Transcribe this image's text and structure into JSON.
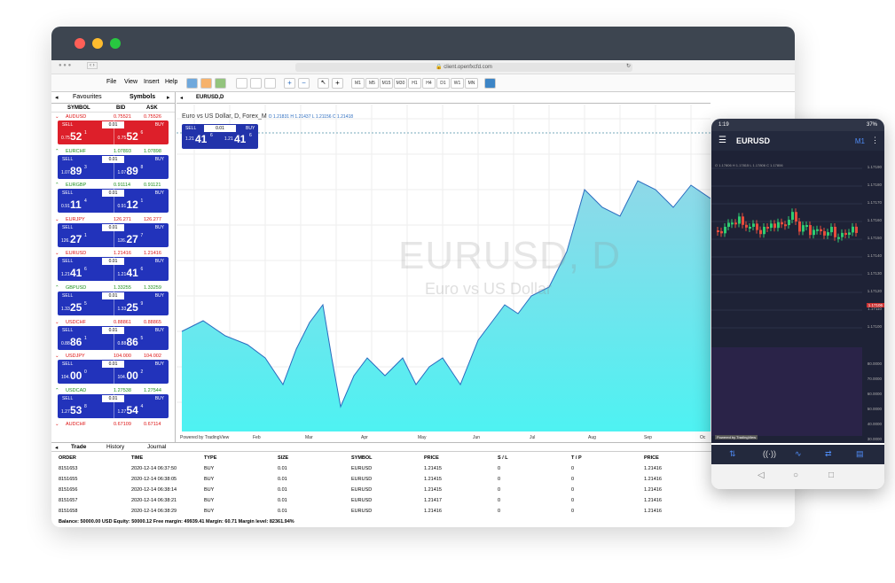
{
  "window": {
    "url": "client.openfxcfd.com"
  },
  "menu": {
    "file": "File",
    "view": "View",
    "insert": "Insert",
    "help": "Help",
    "timeframes": [
      "M1",
      "M5",
      "M15",
      "M30",
      "H1",
      "H4",
      "D1",
      "W1",
      "MN"
    ]
  },
  "sidebar": {
    "tabs": [
      "Favourites",
      "Symbols"
    ],
    "columns": [
      "SYMBOL",
      "BID",
      "ASK"
    ],
    "items": [
      {
        "symbol": "AUDUSD",
        "bid": "0.75521",
        "ask": "0.75526",
        "dir": "down",
        "sell_small": "0.75",
        "sell_big": "52",
        "sell_sup": "1",
        "buy_small": "0.75",
        "buy_big": "52",
        "buy_sup": "6",
        "lot": "0.01",
        "color": "red"
      },
      {
        "symbol": "EURCHF",
        "bid": "1.07893",
        "ask": "1.07898",
        "dir": "up",
        "sell_small": "1.07",
        "sell_big": "89",
        "sell_sup": "3",
        "buy_small": "1.07",
        "buy_big": "89",
        "buy_sup": "8",
        "lot": "0.01",
        "color": "blue"
      },
      {
        "symbol": "EURGBP",
        "bid": "0.91114",
        "ask": "0.91121",
        "dir": "up",
        "sell_small": "0.91",
        "sell_big": "11",
        "sell_sup": "4",
        "buy_small": "0.91",
        "buy_big": "12",
        "buy_sup": "1",
        "lot": "0.01",
        "color": "blue"
      },
      {
        "symbol": "EURJPY",
        "bid": "126.271",
        "ask": "126.277",
        "dir": "down",
        "sell_small": "126.",
        "sell_big": "27",
        "sell_sup": "1",
        "buy_small": "126.",
        "buy_big": "27",
        "buy_sup": "7",
        "lot": "0.01",
        "color": "blue"
      },
      {
        "symbol": "EURUSD",
        "bid": "1.21416",
        "ask": "1.21416",
        "dir": "down",
        "sell_small": "1.21",
        "sell_big": "41",
        "sell_sup": "6",
        "buy_small": "1.21",
        "buy_big": "41",
        "buy_sup": "6",
        "lot": "0.01",
        "color": "blue"
      },
      {
        "symbol": "GBPUSD",
        "bid": "1.33255",
        "ask": "1.33259",
        "dir": "up",
        "sell_small": "1.33",
        "sell_big": "25",
        "sell_sup": "5",
        "buy_small": "1.33",
        "buy_big": "25",
        "buy_sup": "9",
        "lot": "0.01",
        "color": "blue"
      },
      {
        "symbol": "USDCHF",
        "bid": "0.88861",
        "ask": "0.88865",
        "dir": "down",
        "sell_small": "0.88",
        "sell_big": "86",
        "sell_sup": "1",
        "buy_small": "0.88",
        "buy_big": "86",
        "buy_sup": "5",
        "lot": "0.01",
        "color": "blue"
      },
      {
        "symbol": "USDJPY",
        "bid": "104.000",
        "ask": "104.002",
        "dir": "down",
        "sell_small": "104.",
        "sell_big": "00",
        "sell_sup": "0",
        "buy_small": "104.",
        "buy_big": "00",
        "buy_sup": "2",
        "lot": "0.01",
        "color": "blue"
      },
      {
        "symbol": "USDCAD",
        "bid": "1.27538",
        "ask": "1.27544",
        "dir": "up",
        "sell_small": "1.27",
        "sell_big": "53",
        "sell_sup": "8",
        "buy_small": "1.27",
        "buy_big": "54",
        "buy_sup": "4",
        "lot": "0.01",
        "color": "blue"
      },
      {
        "symbol": "AUDCHF",
        "bid": "0.67109",
        "ask": "0.67114",
        "dir": "down"
      }
    ]
  },
  "chart": {
    "tab": "EURUSD,D",
    "legend": "Euro vs US Dollar, D, Forex_M",
    "ohlc": "O 1.21831 H 1.21437 L 1.21156 C 1.21418",
    "watermark": "EURUSD, D",
    "watermark_sub": "Euro vs US Dollar",
    "powered": "Powered by TradingView",
    "months": [
      "Feb",
      "Mar",
      "Apr",
      "May",
      "Jun",
      "Jul",
      "Aug",
      "Sep",
      "Oc"
    ],
    "widget": {
      "sell": "SELL",
      "buy": "BUY",
      "lot": "0.01",
      "sell_small": "1.21",
      "sell_big": "41",
      "sell_sup": "6",
      "buy_small": "1.21",
      "buy_big": "41",
      "buy_sup": "6"
    }
  },
  "bottom": {
    "tabs": [
      "Trade",
      "History",
      "Journal"
    ],
    "columns": [
      "ORDER",
      "TIME",
      "TYPE",
      "SIZE",
      "SYMBOL",
      "PRICE",
      "S / L",
      "T / P",
      "PRICE"
    ],
    "rows": [
      [
        "8151653",
        "2020-12-14 06:37:50",
        "BUY",
        "0.01",
        "EURUSD",
        "1.21415",
        "0",
        "0",
        "1.21416"
      ],
      [
        "8151655",
        "2020-12-14 06:38:05",
        "BUY",
        "0.01",
        "EURUSD",
        "1.21415",
        "0",
        "0",
        "1.21416"
      ],
      [
        "8151656",
        "2020-12-14 06:38:14",
        "BUY",
        "0.01",
        "EURUSD",
        "1.21415",
        "0",
        "0",
        "1.21416"
      ],
      [
        "8151657",
        "2020-12-14 06:38:21",
        "BUY",
        "0.01",
        "EURUSD",
        "1.21417",
        "0",
        "0",
        "1.21416"
      ],
      [
        "8151658",
        "2020-12-14 06:38:29",
        "BUY",
        "0.01",
        "EURUSD",
        "1.21416",
        "0",
        "0",
        "1.21416"
      ]
    ],
    "status": "Balance: 50000.00 USD Equity: 50000.12 Free margin: 49939.41 Margin: 60.71 Margin level: 82361.94%"
  },
  "phone": {
    "time": "1:19",
    "battery": "37%",
    "title": "EURUSD",
    "timeframe": "M1",
    "ohlc": "O 1.17806 H 1.17815 L 1.17806 C 1.17806",
    "prices": [
      "1.17190",
      "1.17180",
      "1.17170",
      "1.17160",
      "1.17150",
      "1.17140",
      "1.17130",
      "1.17120",
      "1.17110",
      "1.17100"
    ],
    "current": "1.17106",
    "osc": [
      "80.0000",
      "70.0000",
      "60.0000",
      "50.0000",
      "40.0000",
      "30.0000"
    ],
    "powered": "Powered by TradingView"
  }
}
